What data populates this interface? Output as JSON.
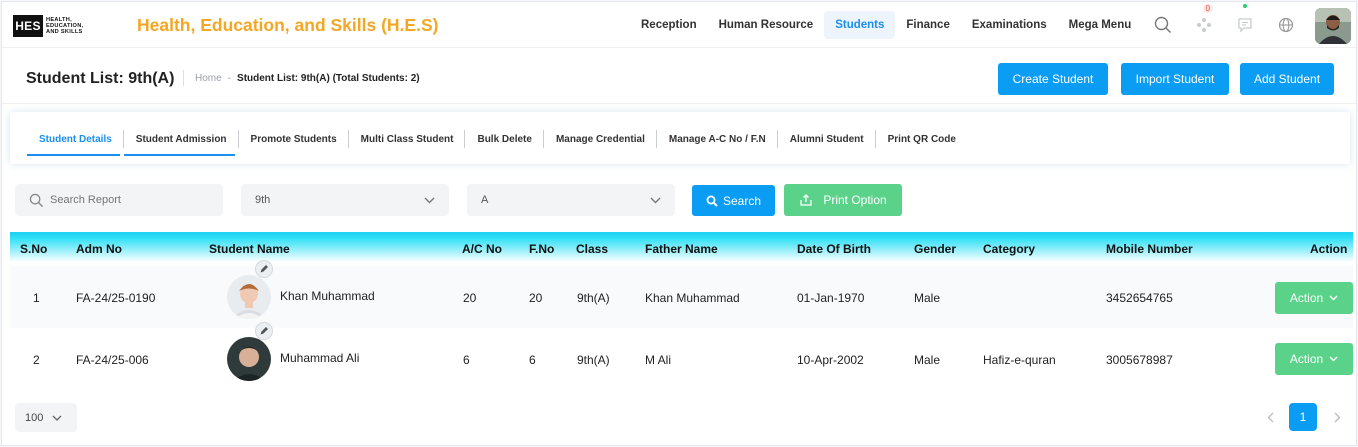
{
  "brand": {
    "logo_mark": "HES",
    "logo_lines": [
      "HEALTH,",
      "EDUCATION,",
      "AND SKILLS"
    ],
    "title": "Health, Education, and Skills (H.E.S)",
    "title_color": "#f5a623"
  },
  "nav": {
    "items": [
      "Reception",
      "Human Resource",
      "Students",
      "Finance",
      "Examinations",
      "Mega Menu"
    ],
    "active": "Students"
  },
  "top_icons": {
    "search": "search-icon",
    "apps": "apps-icon",
    "apps_badge": "0",
    "messages": "message-icon",
    "language": "globe-icon",
    "profile": "user-avatar"
  },
  "page": {
    "title": "Student List: 9th(A)",
    "breadcrumb_home": "Home",
    "breadcrumb_sep": "-",
    "breadcrumb_current": "Student List: 9th(A) (Total Students: 2)",
    "buttons": {
      "create": "Create Student",
      "import": "Import Student",
      "add": "Add Student"
    }
  },
  "tabs": [
    "Student Details",
    "Student Admission",
    "Promote Students",
    "Multi Class Student",
    "Bulk Delete",
    "Manage Credential",
    "Manage A-C No / F.N",
    "Alumni Student",
    "Print QR Code"
  ],
  "filters": {
    "search_placeholder": "Search Report",
    "class_value": "9th",
    "section_value": "A",
    "search_button": "Search",
    "print_button": "Print Option"
  },
  "table": {
    "headers": {
      "sno": "S.No",
      "adm": "Adm No",
      "name": "Student Name",
      "ac": "A/C No",
      "fno": "F.No",
      "class": "Class",
      "father": "Father Name",
      "dob": "Date Of Birth",
      "gender": "Gender",
      "category": "Category",
      "mobile": "Mobile Number",
      "action": "Action"
    },
    "rows": [
      {
        "sno": "1",
        "adm": "FA-24/25-0190",
        "name": "Khan Muhammad",
        "ac": "20",
        "fno": "20",
        "class": "9th(A)",
        "father": "Khan Muhammad",
        "dob": "01-Jan-1970",
        "gender": "Male",
        "category": "",
        "mobile": "3452654765",
        "action": "Action"
      },
      {
        "sno": "2",
        "adm": "FA-24/25-006",
        "name": "Muhammad Ali",
        "ac": "6",
        "fno": "6",
        "class": "9th(A)",
        "father": "M Ali",
        "dob": "10-Apr-2002",
        "gender": "Male",
        "category": "Hafiz-e-quran",
        "mobile": "3005678987",
        "action": "Action"
      }
    ]
  },
  "pagination": {
    "page_size": "100",
    "current_page": "1"
  },
  "colors": {
    "primary": "#0b9cf3",
    "success": "#5bd28a",
    "header_cyan": "#1fd0f0"
  }
}
